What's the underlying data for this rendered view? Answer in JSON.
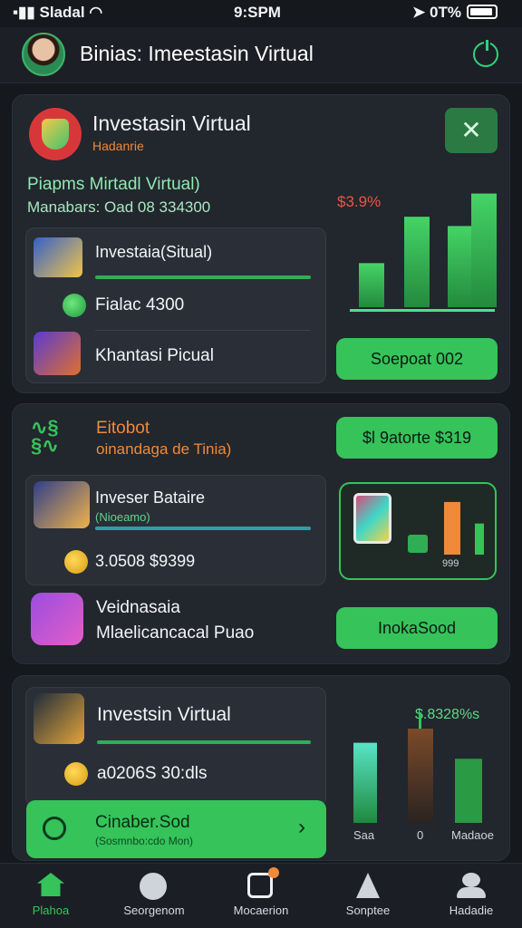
{
  "status_bar": {
    "carrier": "Sladal",
    "time": "9:SPM",
    "battery": "0T%"
  },
  "header": {
    "title": "Binias: Imeestasin Virtual"
  },
  "card1": {
    "title": "Investasin Virtual",
    "subtitle": "Hadanrie",
    "heading": "Piapms Mirtadl Virtual)",
    "amount_line": "Manabars: Oad 08 334300",
    "item1_label": "Investaia(Situal)",
    "item2_label": "Fialac 4300",
    "item3_label": "Khantasi Picual",
    "chart_label": "$3.9%",
    "button": "Soepoat 002"
  },
  "card2": {
    "title": "Eitobot",
    "subtitle": "oinandaga de Tinia)",
    "button_top": "$l 9atorte $319",
    "item1_title": "Inveser Bataire",
    "item1_sub": "(Nioeamo)",
    "item2_value": "3.0508 $9399",
    "item3_title": "Veidnasaia",
    "item3_sub": "Mlaelicancacal Puao",
    "button_bottom": "InokaSood",
    "mini_chart_label": "999"
  },
  "card3": {
    "item1_title": "Investsin Virtual",
    "item2_value": "a0206S 30:dls",
    "cta_title": "Cinaber.Sod",
    "cta_sub": "(Sosmnbo:cdo Mon)",
    "chart_label": "$.8328%s",
    "axis_left": "Saa",
    "axis_mid": "0",
    "axis_right": "Madaoe"
  },
  "tabs": [
    {
      "label": "Plahoa"
    },
    {
      "label": "Seorgenom"
    },
    {
      "label": "Mocaerion"
    },
    {
      "label": "Sonptee"
    },
    {
      "label": "Hadadie"
    }
  ],
  "colors": {
    "accent": "#35c35a",
    "bg": "#15181d",
    "card": "#22262d",
    "orange": "#ef8a3a"
  },
  "chart_data": [
    {
      "type": "bar",
      "values": [
        38,
        78,
        70,
        98
      ],
      "series": [
        {
          "values": [
            38,
            78,
            70,
            98
          ]
        }
      ]
    },
    {
      "type": "bar",
      "values": [
        88,
        52
      ],
      "series": [
        {
          "values": [
            88,
            52
          ]
        }
      ]
    },
    {
      "type": "bar",
      "values": [
        85,
        100,
        68
      ],
      "series": [
        {
          "values": [
            85,
            100,
            68
          ]
        }
      ]
    }
  ]
}
